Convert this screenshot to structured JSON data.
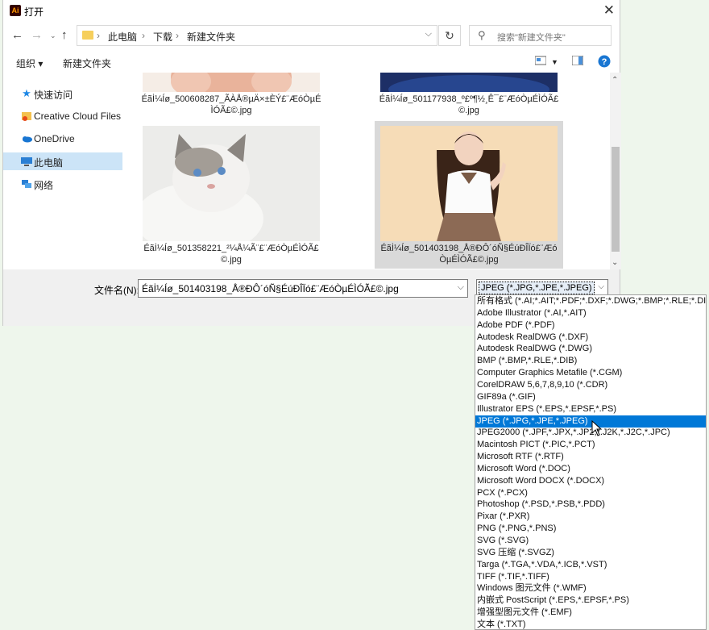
{
  "window": {
    "title": "打开",
    "app_icon_text": "Ai"
  },
  "nav": {
    "breadcrumbs": [
      "此电脑",
      "下载",
      "新建文件夹"
    ],
    "search_placeholder": "搜索\"新建文件夹\""
  },
  "toolbar": {
    "organize_label": "组织 ▾",
    "new_folder_label": "新建文件夹"
  },
  "sidebar": {
    "items": [
      {
        "label": "快速访问",
        "icon": "star-icon"
      },
      {
        "label": "Creative Cloud Files",
        "icon": "creative-cloud-icon"
      },
      {
        "label": "OneDrive",
        "icon": "cloud-icon"
      },
      {
        "label": "此电脑",
        "icon": "computer-icon",
        "selected": true
      },
      {
        "label": "网络",
        "icon": "network-icon"
      }
    ]
  },
  "files": [
    {
      "line1": "Éãİ¼Íø_500608287_ÃÀÅ®µÄ×±ÈÝ£¨ÆóÒµÉ",
      "line2": "ÌÓÃ£©.jpg"
    },
    {
      "line1": "Éãİ¼Íø_501177938_º£º¶½¸Ê¯£¨ÆóÒµÉÌÓÃ£",
      "line2": "©.jpg"
    },
    {
      "line1": "Éãİ¼Íø_501358221_²¼Å¼Ã¨£¨ÆóÒµÉÌÓÃ£",
      "line2": "©.jpg"
    },
    {
      "line1": "Éãİ¼Íø_501403198_Å®ÐÔ´óÑ§ÉúÐÎÏó£¨Æó",
      "line2": "ÒµÉÌÓÃ£©.jpg"
    }
  ],
  "bottom": {
    "filename_label": "文件名(N):",
    "filename_value": "Éãİ¼Íø_501403198_Å®ÐÔ´óÑ§ÉúÐÎÏó£¨ÆóÒµÉÌÓÃ£©.jpg",
    "type_selected": "JPEG (*.JPG,*.JPE,*.JPEG)"
  },
  "type_options": [
    "所有格式 (*.AI;*.AIT;*.PDF;*.DXF;*.DWG;*.BMP;*.RLE;*.DIB;*.",
    "Adobe Illustrator (*.AI,*.AIT)",
    "Adobe PDF (*.PDF)",
    "Autodesk RealDWG (*.DXF)",
    "Autodesk RealDWG (*.DWG)",
    "BMP (*.BMP,*.RLE,*.DIB)",
    "Computer Graphics Metafile (*.CGM)",
    "CorelDRAW 5,6,7,8,9,10 (*.CDR)",
    "GIF89a (*.GIF)",
    "Illustrator EPS (*.EPS,*.EPSF,*.PS)",
    "JPEG (*.JPG,*.JPE,*.JPEG)",
    "JPEG2000 (*.JPF,*.JPX,*.JP2,*.J2K,*.J2C,*.JPC)",
    "Macintosh PICT (*.PIC,*.PCT)",
    "Microsoft RTF (*.RTF)",
    "Microsoft Word (*.DOC)",
    "Microsoft Word DOCX (*.DOCX)",
    "PCX (*.PCX)",
    "Photoshop (*.PSD,*.PSB,*.PDD)",
    "Pixar (*.PXR)",
    "PNG (*.PNG,*.PNS)",
    "SVG (*.SVG)",
    "SVG 压缩 (*.SVGZ)",
    "Targa (*.TGA,*.VDA,*.ICB,*.VST)",
    "TIFF (*.TIF,*.TIFF)",
    "Windows 图元文件 (*.WMF)",
    "内嵌式 PostScript (*.EPS,*.EPSF,*.PS)",
    "增强型图元文件 (*.EMF)",
    "文本 (*.TXT)"
  ],
  "highlighted_option_index": 10
}
